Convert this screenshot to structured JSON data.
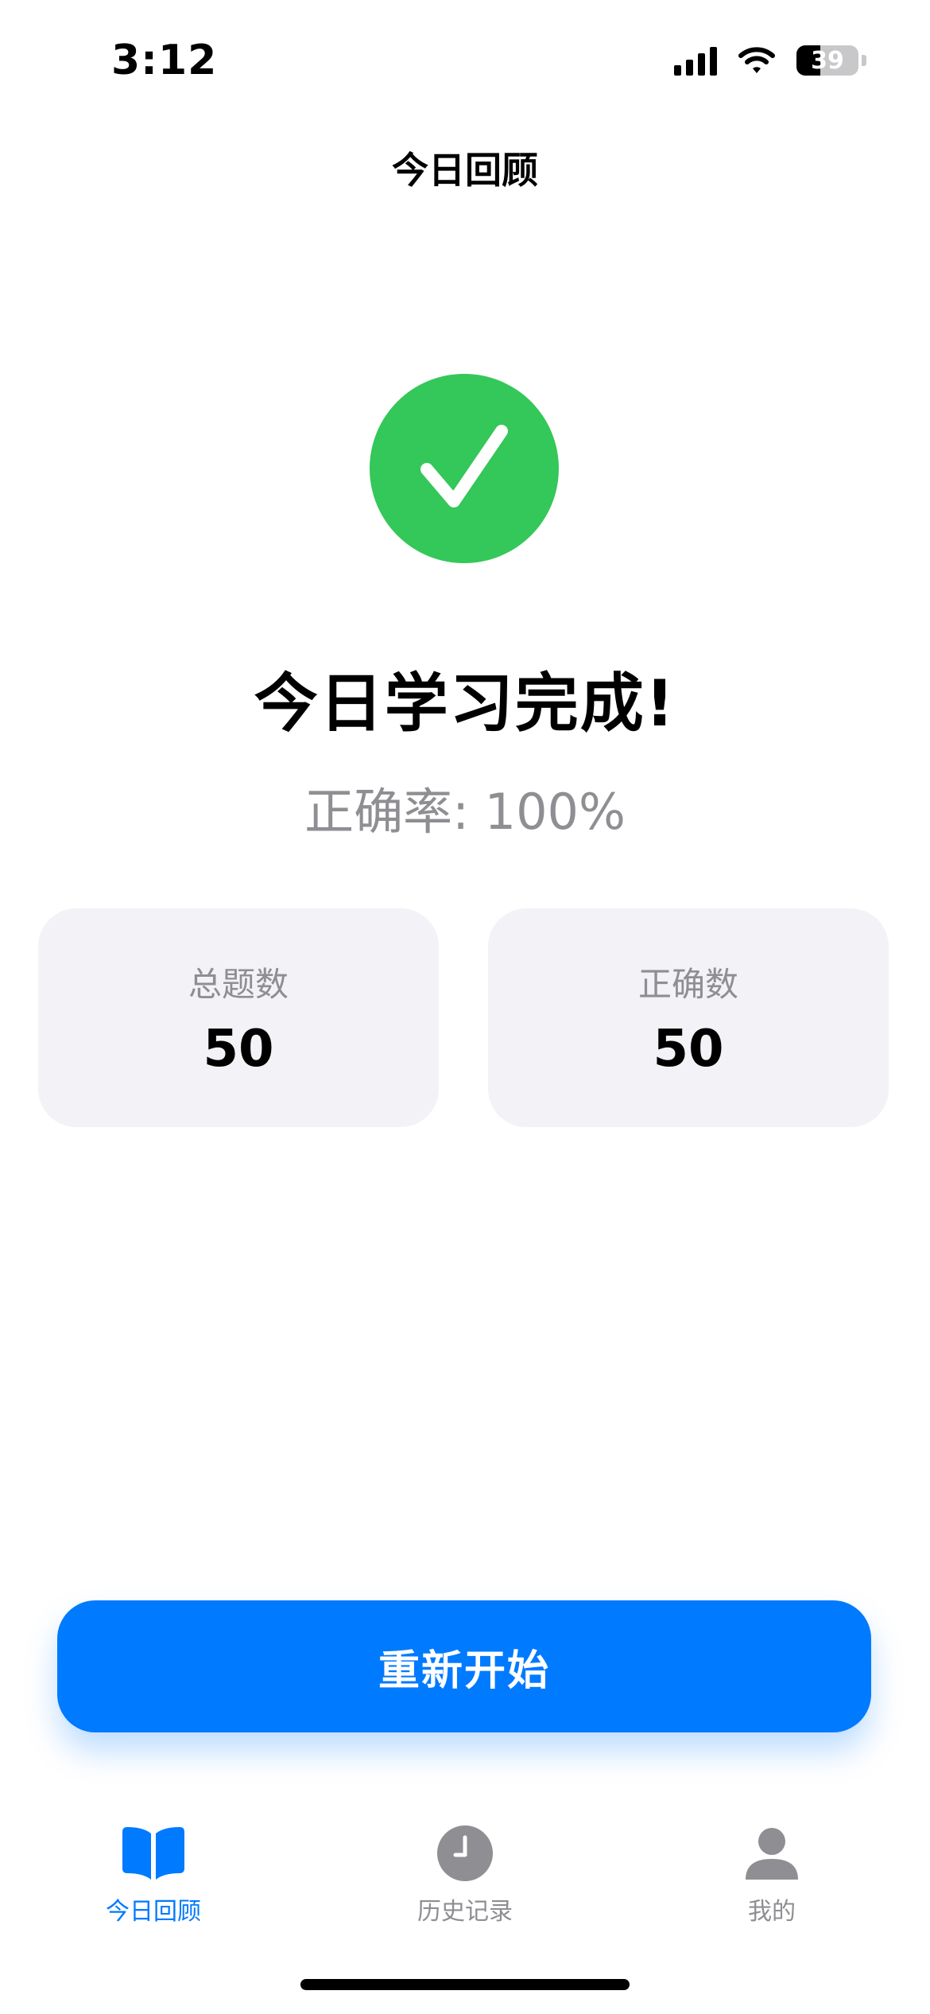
{
  "status_bar": {
    "time": "3:12",
    "battery": "39",
    "battery_level": 0.39
  },
  "nav": {
    "title": "今日回顾"
  },
  "result": {
    "headline": "今日学习完成!",
    "accuracy": "正确率: 100%"
  },
  "stats": [
    {
      "label": "总题数",
      "value": "50"
    },
    {
      "label": "正确数",
      "value": "50"
    }
  ],
  "restart_button": {
    "label": "重新开始"
  },
  "tabs": [
    {
      "label": "今日回顾",
      "icon": "book-icon",
      "active": true
    },
    {
      "label": "历史记录",
      "icon": "clock-icon",
      "active": false
    },
    {
      "label": "我的",
      "icon": "person-icon",
      "active": false
    }
  ],
  "colors": {
    "accent": "#007aff",
    "success": "#34c759",
    "card_bg": "#f2f2f7",
    "secondary_text": "#8e8e93"
  }
}
